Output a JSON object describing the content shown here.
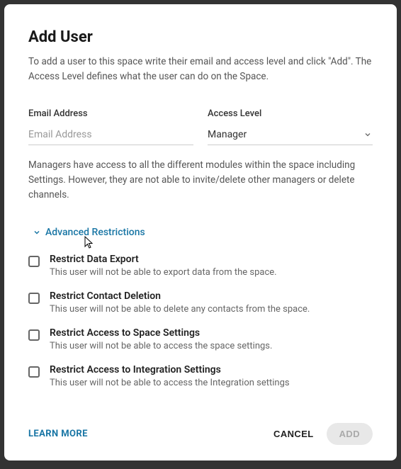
{
  "dialog": {
    "title": "Add User",
    "description": "To add a user to this space write their email and access level and click \"Add\". The Access Level defines what the user can do on the Space."
  },
  "fields": {
    "email_label": "Email Address",
    "email_placeholder": "Email Address",
    "email_value": "",
    "access_label": "Access Level",
    "access_value": "Manager"
  },
  "role_description": "Managers have access to all the different modules within the space including Settings. However, they are not able to invite/delete other managers or delete channels.",
  "advanced": {
    "toggle_label": "Advanced Restrictions",
    "items": [
      {
        "title": "Restrict Data Export",
        "desc": "This user will not be able to export data from the space.",
        "checked": false
      },
      {
        "title": "Restrict Contact Deletion",
        "desc": "This user will not be able to delete any contacts from the space.",
        "checked": false
      },
      {
        "title": "Restrict Access to Space Settings",
        "desc": "This user will not be able to access the space settings.",
        "checked": false
      },
      {
        "title": "Restrict Access to Integration Settings",
        "desc": "This user will not be able to access the Integration settings",
        "checked": false
      }
    ]
  },
  "footer": {
    "learn_more": "LEARN MORE",
    "cancel": "CANCEL",
    "add": "ADD"
  }
}
